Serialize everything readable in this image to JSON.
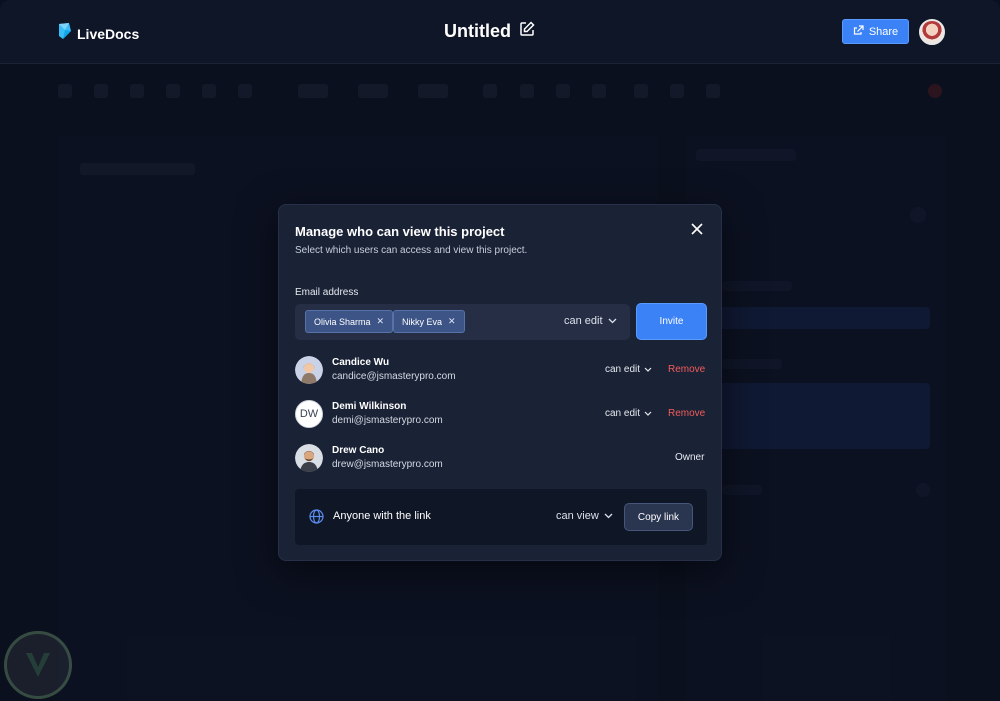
{
  "app": {
    "name": "LiveDocs"
  },
  "header": {
    "doc_title": "Untitled",
    "share_label": "Share"
  },
  "modal": {
    "title": "Manage who can view this project",
    "subtitle": "Select which users can access and view this project.",
    "email_label": "Email address",
    "chips": [
      "Olivia Sharma",
      "Nikky Eva"
    ],
    "input_permission": "can edit",
    "invite_label": "Invite",
    "users": [
      {
        "name": "Candice Wu",
        "email": "candice@jsmasterypro.com",
        "permission": "can edit",
        "action": "Remove"
      },
      {
        "name": "Demi Wilkinson",
        "email": "demi@jsmasterypro.com",
        "initials": "DW",
        "permission": "can edit",
        "action": "Remove"
      },
      {
        "name": "Drew Cano",
        "email": "drew@jsmasterypro.com",
        "role": "Owner"
      }
    ],
    "link": {
      "label": "Anyone with the link",
      "permission": "can view",
      "copy_label": "Copy link"
    }
  },
  "colors": {
    "accent": "#3b82f6",
    "danger": "#f25c5c",
    "background": "#0d1424",
    "modal": "#1a2235"
  }
}
